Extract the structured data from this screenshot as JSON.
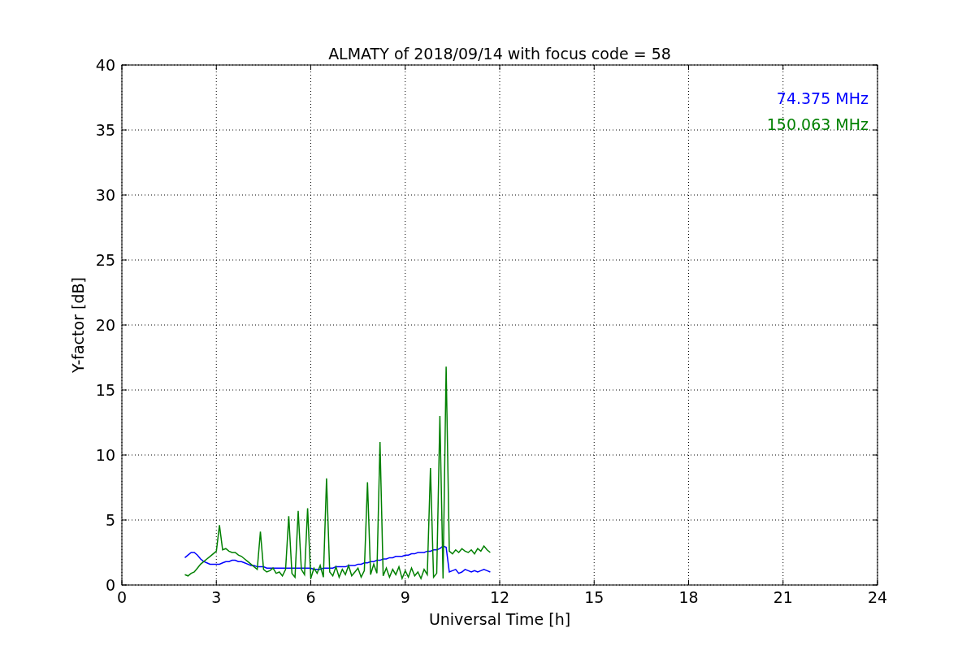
{
  "figure": {
    "chart_data": {
      "type": "line",
      "title": "ALMATY of 2018/09/14 with focus code = 58",
      "xlabel": "Universal Time [h]",
      "ylabel": "Y-factor [dB]",
      "xlim": [
        0,
        24
      ],
      "ylim": [
        0,
        40
      ],
      "xticks": [
        0,
        3,
        6,
        9,
        12,
        15,
        18,
        21,
        24
      ],
      "yticks": [
        0,
        5,
        10,
        15,
        20,
        25,
        30,
        35,
        40
      ],
      "grid": true,
      "x": [
        2.0,
        2.1,
        2.2,
        2.3,
        2.4,
        2.5,
        2.6,
        2.7,
        2.8,
        2.9,
        3.0,
        3.1,
        3.2,
        3.3,
        3.4,
        3.5,
        3.6,
        3.7,
        3.8,
        3.9,
        4.0,
        4.1,
        4.2,
        4.3,
        4.4,
        4.5,
        4.6,
        4.7,
        4.8,
        4.9,
        5.0,
        5.1,
        5.2,
        5.3,
        5.4,
        5.5,
        5.6,
        5.7,
        5.8,
        5.9,
        6.0,
        6.1,
        6.2,
        6.3,
        6.4,
        6.5,
        6.6,
        6.7,
        6.8,
        6.9,
        7.0,
        7.1,
        7.2,
        7.3,
        7.4,
        7.5,
        7.6,
        7.7,
        7.8,
        7.9,
        8.0,
        8.1,
        8.2,
        8.3,
        8.4,
        8.5,
        8.6,
        8.7,
        8.8,
        8.9,
        9.0,
        9.1,
        9.2,
        9.3,
        9.4,
        9.5,
        9.6,
        9.7,
        9.8,
        9.9,
        10.0,
        10.1,
        10.2,
        10.3,
        10.4,
        10.5,
        10.6,
        10.7,
        10.8,
        10.9,
        11.0,
        11.1,
        11.2,
        11.3,
        11.4,
        11.5,
        11.6,
        11.7
      ],
      "series": [
        {
          "name": "74.375 MHz",
          "color": "#0000ff",
          "values": [
            2.1,
            2.3,
            2.5,
            2.5,
            2.3,
            2.0,
            1.8,
            1.7,
            1.6,
            1.6,
            1.6,
            1.6,
            1.7,
            1.8,
            1.8,
            1.9,
            1.9,
            1.8,
            1.8,
            1.7,
            1.6,
            1.5,
            1.5,
            1.4,
            1.4,
            1.4,
            1.3,
            1.3,
            1.3,
            1.3,
            1.3,
            1.3,
            1.3,
            1.3,
            1.3,
            1.3,
            1.3,
            1.3,
            1.3,
            1.3,
            1.3,
            1.2,
            1.2,
            1.2,
            1.3,
            1.3,
            1.3,
            1.3,
            1.4,
            1.4,
            1.4,
            1.4,
            1.5,
            1.5,
            1.5,
            1.6,
            1.6,
            1.7,
            1.7,
            1.8,
            1.8,
            1.9,
            1.9,
            2.0,
            2.0,
            2.1,
            2.1,
            2.2,
            2.2,
            2.2,
            2.3,
            2.3,
            2.4,
            2.4,
            2.5,
            2.5,
            2.5,
            2.6,
            2.6,
            2.7,
            2.7,
            2.8,
            3.0,
            2.9,
            1.0,
            1.1,
            1.2,
            0.9,
            1.0,
            1.2,
            1.1,
            1.0,
            1.1,
            1.0,
            1.1,
            1.2,
            1.1,
            1.0
          ]
        },
        {
          "name": "150.063 MHz",
          "color": "#008000",
          "values": [
            0.8,
            0.7,
            0.9,
            1.0,
            1.3,
            1.6,
            1.8,
            2.0,
            2.2,
            2.4,
            2.6,
            4.6,
            2.7,
            2.8,
            2.6,
            2.5,
            2.5,
            2.3,
            2.2,
            2.0,
            1.8,
            1.6,
            1.4,
            1.2,
            4.1,
            1.2,
            1.0,
            1.1,
            1.3,
            0.9,
            1.0,
            0.7,
            1.2,
            5.3,
            0.9,
            0.6,
            5.7,
            1.2,
            0.8,
            5.9,
            0.5,
            1.3,
            0.9,
            1.5,
            0.6,
            8.2,
            1.0,
            0.7,
            1.4,
            0.6,
            1.2,
            0.8,
            1.5,
            0.7,
            1.0,
            1.3,
            0.6,
            1.1,
            7.9,
            0.8,
            1.6,
            0.9,
            11.0,
            0.7,
            1.3,
            0.6,
            1.2,
            0.8,
            1.4,
            0.5,
            1.1,
            0.6,
            1.3,
            0.7,
            1.0,
            0.5,
            1.2,
            0.8,
            9.0,
            0.6,
            0.9,
            13.0,
            0.5,
            16.8,
            2.6,
            2.4,
            2.7,
            2.5,
            2.8,
            2.6,
            2.5,
            2.7,
            2.4,
            2.8,
            2.6,
            3.0,
            2.7,
            2.5
          ]
        }
      ]
    }
  }
}
